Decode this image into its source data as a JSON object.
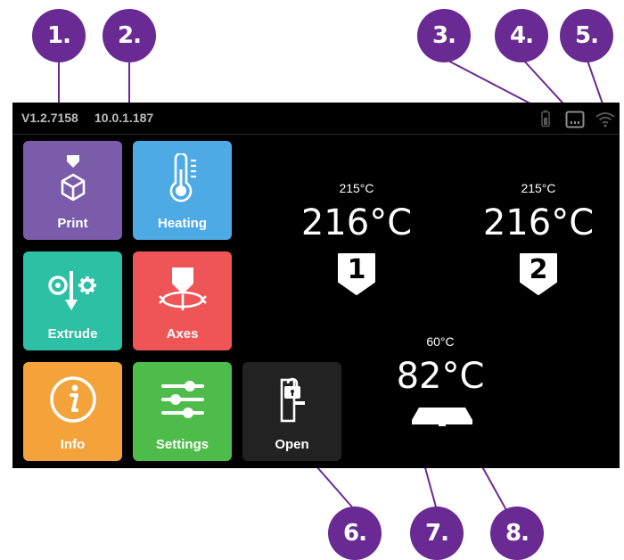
{
  "callouts": [
    "1.",
    "2.",
    "3.",
    "4.",
    "5.",
    "6.",
    "7.",
    "8."
  ],
  "status": {
    "version": "V1.2.7158",
    "ip": "10.0.1.187"
  },
  "icons": {
    "status": [
      "battery-icon",
      "ethernet-icon",
      "wifi-icon"
    ]
  },
  "tiles": {
    "print": "Print",
    "heating": "Heating",
    "extrude": "Extrude",
    "axes": "Axes",
    "info": "Info",
    "settings": "Settings",
    "open": "Open"
  },
  "colors": {
    "callout": "#6a2a93",
    "print": "#7b5cab",
    "heating": "#4eaae5",
    "extrude": "#2cc0a4",
    "axes": "#ef5557",
    "info": "#f3a33a",
    "settings": "#4ebc4a",
    "open": "#222222"
  },
  "extruders": [
    {
      "target": "215°C",
      "current": "216°C",
      "label": "1"
    },
    {
      "target": "215°C",
      "current": "216°C",
      "label": "2"
    }
  ],
  "bed": {
    "target": "60°C",
    "current": "82°C"
  }
}
